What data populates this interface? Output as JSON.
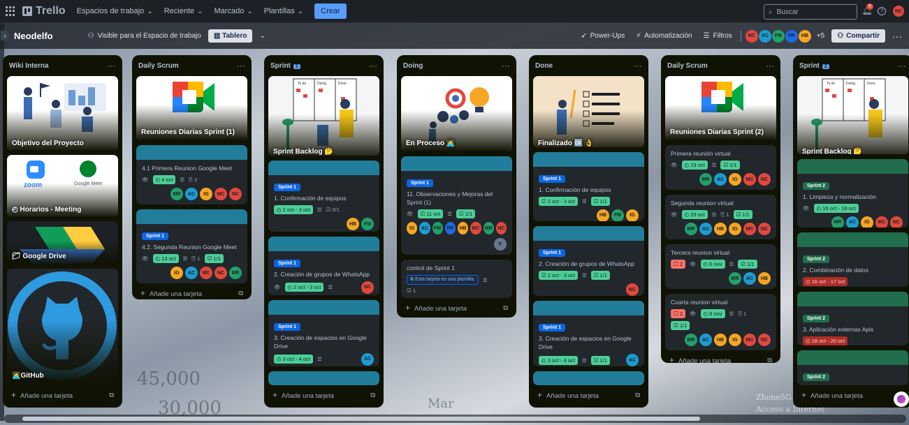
{
  "top_nav": {
    "logo": "Trello",
    "menu": [
      "Espacios de trabajo",
      "Reciente",
      "Marcado",
      "Plantillas"
    ],
    "create": "Crear",
    "search_placeholder": "Buscar",
    "notifications_count": "5",
    "user_initials": "NC"
  },
  "board_bar": {
    "title": "Neodelfo",
    "visibility": "Visible para el Espacio de trabajo",
    "view": "Tablero",
    "powerups": "Power-Ups",
    "automation": "Automatización",
    "filters": "Filtros",
    "members": [
      "NC",
      "AC",
      "FM",
      "FR",
      "HB"
    ],
    "extra_members": "+5",
    "share": "Compartir"
  },
  "add_card_label": "Añade una tarjeta",
  "lists": {
    "wiki": {
      "title": "Wiki Interna",
      "cards": [
        "Objetivo del Proyecto",
        "Horarios - Meeting",
        "Google Drive",
        "GitHub"
      ],
      "zoom_text": "zoom",
      "meet_text": "Google Meet"
    },
    "daily": {
      "title": "Daily Scrum",
      "cover_title": "Reuniones Diarias Sprint (1)",
      "cards": [
        {
          "title": "4.1 Primera Reunion Google Meet",
          "date": "4 oct",
          "attachments": "2",
          "members": [
            "MR",
            "AC",
            "IG",
            "MC",
            "NC"
          ]
        },
        {
          "label": "Sprint 1",
          "title": "4.2. Segunda Reunion Google Meet",
          "date": "13 oct",
          "attachments": "1",
          "checklist": "1/1",
          "members": [
            "IG",
            "AC",
            "MC",
            "NC",
            "MR"
          ]
        }
      ]
    },
    "sprint1": {
      "title": "Sprint",
      "num": "1",
      "cover_title": "Sprint Backlog 🤔",
      "cards": [
        {
          "label": "Sprint 1",
          "title": "1. Confirmación de equipos",
          "date": "2 oct - 3 oct",
          "checklist": "0/1",
          "members": [
            "HB",
            "FM"
          ]
        },
        {
          "label": "Sprint 1",
          "title": "2. Creación de grupos de WhatsApp",
          "date": "2 oct - 3 oct",
          "members": [
            "NC"
          ]
        },
        {
          "label": "Sprint 1",
          "title": "3. Creación de espacios en Google Drive",
          "date": "3 oct - 4 oct",
          "members": [
            "AC"
          ]
        }
      ]
    },
    "doing": {
      "title": "Doing",
      "cover_title": "En Proceso 🧑‍💻",
      "cards": [
        {
          "label": "Sprint 1",
          "title": "11. Observaciones y Mejoras del Sprint (1)",
          "date": "11 oct",
          "checklist": "1/1",
          "members": [
            "IG",
            "AC",
            "FM",
            "FR",
            "HB",
            "MC",
            "MR",
            "NC"
          ],
          "members2": [
            "P"
          ]
        },
        {
          "title": "control de Sprint 1",
          "template": "Esta tarjeta es una plantilla.",
          "checklist": "1"
        }
      ]
    },
    "done": {
      "title": "Done",
      "cover_title": "Finalizado 🆗 👌",
      "cards": [
        {
          "label": "Sprint 1",
          "title": "1. Confirmación de equipos",
          "date": "2 oct - 3 oct",
          "checklist": "1/1",
          "members": [
            "HB",
            "FM",
            "IG"
          ]
        },
        {
          "label": "Sprint 1",
          "title": "2. Creación de grupos de WhatsApp",
          "date": "2 oct - 3 oct",
          "checklist": "1/1",
          "members": [
            "NC"
          ]
        },
        {
          "label": "Sprint 1",
          "title": "3. Creación de espacios en Google Drive",
          "date": "3 oct - 4 oct",
          "checklist": "1/1",
          "members": [
            "AC"
          ]
        }
      ]
    },
    "daily2": {
      "title": "Daily Scrum",
      "cover_title": "Reuniones Diarias Sprint (2)",
      "cards": [
        {
          "title": "Primera reunión virtual",
          "date": "19 oct",
          "checklist": "1/1",
          "members": [
            "MR",
            "AC",
            "IG",
            "MC",
            "NC"
          ]
        },
        {
          "title": "Segunda reunion virtual",
          "date": "29 oct",
          "attachments": "1",
          "checklist": "1/1",
          "members": [
            "MR",
            "AC",
            "HB",
            "IG",
            "MC",
            "NC"
          ]
        },
        {
          "title": "Tercera reunion virtual",
          "red": "2",
          "date": "6 nov",
          "checklist": "1/1",
          "members": [
            "MR",
            "AC",
            "HB"
          ]
        },
        {
          "title": "Cuarta reunion virtual",
          "red": "2",
          "date": "8 nov",
          "attachments": "1",
          "checklist": "1/1",
          "members": [
            "MR",
            "AC",
            "HB",
            "IG",
            "MC",
            "NC"
          ]
        }
      ]
    },
    "sprint2": {
      "title": "Sprint",
      "num": "2",
      "cover_title": "Sprint Backlog 🤔",
      "cards": [
        {
          "label": "Sprint 2",
          "title": "1. Limpieza y normalización",
          "date": "16 oct - 18 oct",
          "members": [
            "MR",
            "AC",
            "IG",
            "MC",
            "NC"
          ]
        },
        {
          "label": "Sprint 2",
          "title": "2. Combinación de datos",
          "date": "16 oct - 17 oct"
        },
        {
          "label": "Sprint 2",
          "title": "3. Aplicación externas Apis",
          "date": "18 oct - 20 oct"
        },
        {
          "label": "Sprint 2"
        }
      ]
    }
  },
  "background_text": [
    "45,000",
    "30,000",
    "Mar",
    "Zhone5G.BL",
    "Acceso a Internet"
  ],
  "colors": {
    "MR": "#22a06b",
    "AC": "#1d9bd1",
    "IG": "#f5a623",
    "MC": "#e2483d",
    "NC": "#e2483d",
    "HB": "#f5a623",
    "FM": "#22a06b",
    "FR": "#1d6ae5",
    "P": "#6b778c"
  }
}
